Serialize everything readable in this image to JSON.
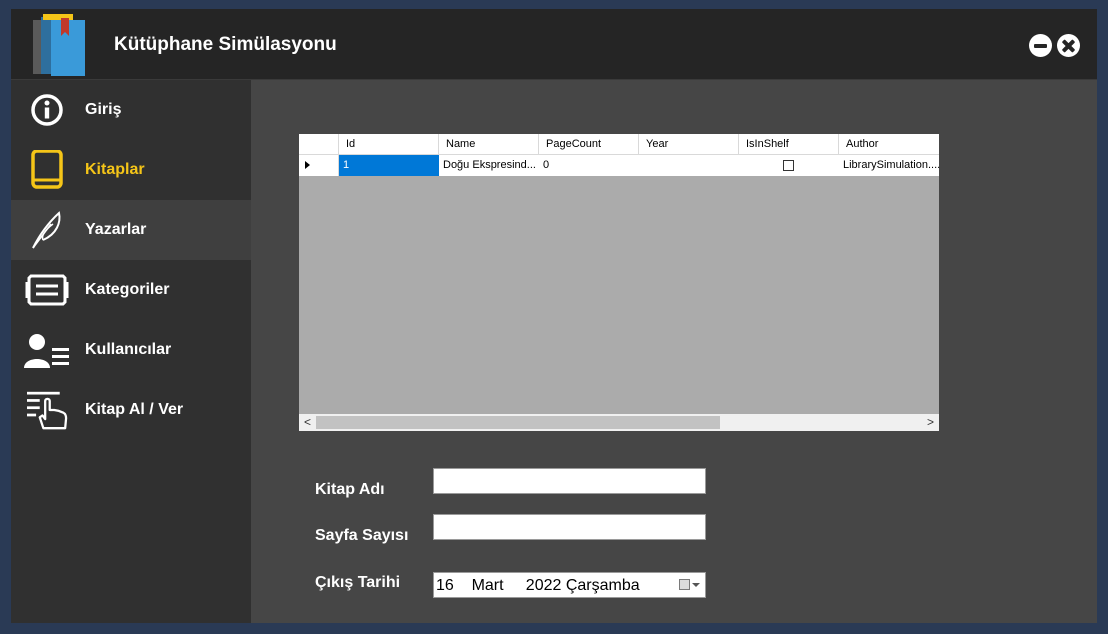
{
  "window": {
    "title": "Kütüphane Simülasyonu"
  },
  "sidebar": {
    "items": [
      {
        "label": "Giriş",
        "icon": "info-icon"
      },
      {
        "label": "Kitaplar",
        "icon": "book-icon"
      },
      {
        "label": "Yazarlar",
        "icon": "feather-icon"
      },
      {
        "label": "Kategoriler",
        "icon": "list-card-icon"
      },
      {
        "label": "Kullanıcılar",
        "icon": "user-list-icon"
      },
      {
        "label": "Kitap Al / Ver",
        "icon": "hand-pointer-icon"
      }
    ],
    "active_color": "#f5c518"
  },
  "grid": {
    "columns": [
      "Id",
      "Name",
      "PageCount",
      "Year",
      "IsInShelf",
      "Author"
    ],
    "rows": [
      {
        "id": "1",
        "name": "Doğu Ekspresind...",
        "page_count": "0",
        "year": "",
        "is_in_shelf": false,
        "author": "LibrarySimulation...."
      }
    ],
    "selection_color": "#0078d7"
  },
  "form": {
    "book_name_label": "Kitap Adı",
    "book_name_value": "",
    "page_count_label": "Sayfa Sayısı",
    "page_count_value": "",
    "release_date_label": "Çıkış Tarihi",
    "release_date_value": "16    Mart     2022 Çarşamba"
  }
}
